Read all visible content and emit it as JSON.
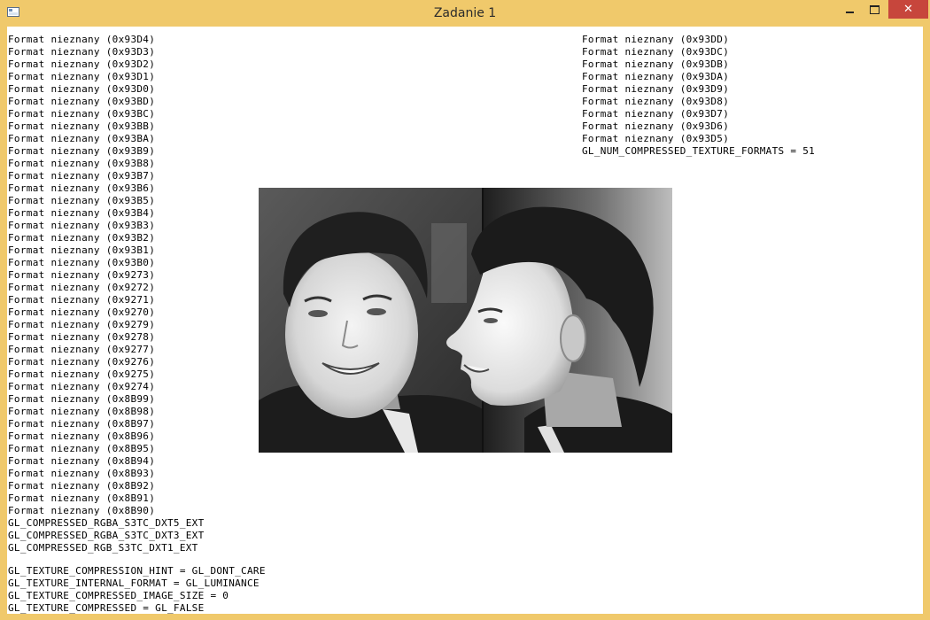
{
  "window": {
    "title": "Zadanie 1",
    "minimize_icon": "minimize-icon",
    "maximize_icon": "maximize-icon",
    "close_icon": "close-icon",
    "close_glyph": "✕"
  },
  "left_column": [
    "Format nieznany (0x93D4)",
    "Format nieznany (0x93D3)",
    "Format nieznany (0x93D2)",
    "Format nieznany (0x93D1)",
    "Format nieznany (0x93D0)",
    "Format nieznany (0x93BD)",
    "Format nieznany (0x93BC)",
    "Format nieznany (0x93BB)",
    "Format nieznany (0x93BA)",
    "Format nieznany (0x93B9)",
    "Format nieznany (0x93B8)",
    "Format nieznany (0x93B7)",
    "Format nieznany (0x93B6)",
    "Format nieznany (0x93B5)",
    "Format nieznany (0x93B4)",
    "Format nieznany (0x93B3)",
    "Format nieznany (0x93B2)",
    "Format nieznany (0x93B1)",
    "Format nieznany (0x93B0)",
    "Format nieznany (0x9273)",
    "Format nieznany (0x9272)",
    "Format nieznany (0x9271)",
    "Format nieznany (0x9270)",
    "Format nieznany (0x9279)",
    "Format nieznany (0x9278)",
    "Format nieznany (0x9277)",
    "Format nieznany (0x9276)",
    "Format nieznany (0x9275)",
    "Format nieznany (0x9274)",
    "Format nieznany (0x8B99)",
    "Format nieznany (0x8B98)",
    "Format nieznany (0x8B97)",
    "Format nieznany (0x8B96)",
    "Format nieznany (0x8B95)",
    "Format nieznany (0x8B94)",
    "Format nieznany (0x8B93)",
    "Format nieznany (0x8B92)",
    "Format nieznany (0x8B91)",
    "Format nieznany (0x8B90)",
    "GL_COMPRESSED_RGBA_S3TC_DXT5_EXT",
    "GL_COMPRESSED_RGBA_S3TC_DXT3_EXT",
    "GL_COMPRESSED_RGB_S3TC_DXT1_EXT"
  ],
  "right_column": [
    "Format nieznany (0x93DD)",
    "Format nieznany (0x93DC)",
    "Format nieznany (0x93DB)",
    "Format nieznany (0x93DA)",
    "Format nieznany (0x93D9)",
    "Format nieznany (0x93D8)",
    "Format nieznany (0x93D7)",
    "Format nieznany (0x93D6)",
    "Format nieznany (0x93D5)",
    "GL_NUM_COMPRESSED_TEXTURE_FORMATS = 51"
  ],
  "bottom_lines": [
    "GL_TEXTURE_COMPRESSION_HINT = GL_DONT_CARE",
    "GL_TEXTURE_INTERNAL_FORMAT = GL_LUMINANCE",
    "GL_TEXTURE_COMPRESSED_IMAGE_SIZE = 0",
    "GL_TEXTURE_COMPRESSED = GL_FALSE"
  ],
  "image": {
    "icon": "texture-image",
    "description_visible": ""
  },
  "colors": {
    "titlebar": "#f0c96b",
    "close_button": "#c7463c",
    "client_background": "#ffffff",
    "text": "#000000"
  }
}
